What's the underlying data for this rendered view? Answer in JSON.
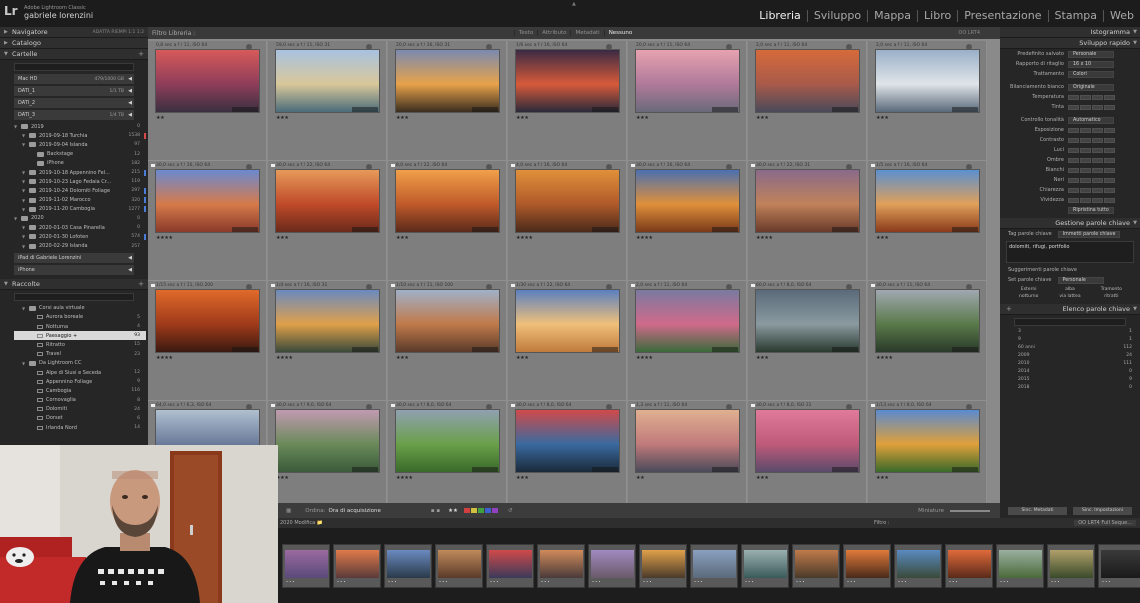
{
  "app": {
    "name": "Adobe Lightroom Classic",
    "user": "gabriele lorenzini"
  },
  "modules": [
    "Libreria",
    "Sviluppo",
    "Mappa",
    "Libro",
    "Presentazione",
    "Stampa",
    "Web"
  ],
  "left_panel": {
    "navigator": {
      "title": "Navigatore",
      "zoom": "ADATTA  RIEMPI  1:1  1:2"
    },
    "catalog": "Catalogo",
    "folders": {
      "title": "Cartelle",
      "volumes": [
        {
          "name": "Mac HD",
          "count": "479/1000 GB"
        },
        {
          "name": "DATI_1",
          "count": "1/1 TB"
        },
        {
          "name": "DATI_2",
          "count": ""
        },
        {
          "name": "DATI_3",
          "count": "1/4 TB"
        }
      ],
      "tree": [
        {
          "indent": 0,
          "label": "2019",
          "count": "0"
        },
        {
          "indent": 1,
          "label": "2019-09-18 Turchia",
          "count": "1538",
          "mark": "#d64a4a"
        },
        {
          "indent": 1,
          "label": "2019-09-04 Islanda",
          "count": "97"
        },
        {
          "indent": 2,
          "label": "Backstage",
          "count": "12"
        },
        {
          "indent": 2,
          "label": "iPhone",
          "count": "182"
        },
        {
          "indent": 1,
          "label": "2019-10-18 Appennino Fel...",
          "count": "215",
          "mark": "#4a7bd6"
        },
        {
          "indent": 1,
          "label": "2019-10-23 Lago Fedaia Cr...",
          "count": "119"
        },
        {
          "indent": 1,
          "label": "2019-10-24 Dolomiti Foliage",
          "count": "297",
          "mark": "#4a7bd6"
        },
        {
          "indent": 1,
          "label": "2019-11-02 Marocco",
          "count": "320",
          "mark": "#4a7bd6"
        },
        {
          "indent": 1,
          "label": "2019-11-20 Cambogia",
          "count": "1277",
          "mark": "#4a7bd6"
        },
        {
          "indent": 0,
          "label": "2020",
          "count": "0"
        },
        {
          "indent": 1,
          "label": "2020-01-03 Casa Pinarella",
          "count": "0"
        },
        {
          "indent": 1,
          "label": "2020-01-30 Lofoten",
          "count": "574",
          "mark": "#4a7bd6"
        },
        {
          "indent": 1,
          "label": "2020-02-29 Islanda",
          "count": "257"
        }
      ],
      "devices": [
        {
          "name": "iPad di Gabriele Lorenzini"
        },
        {
          "name": "iPhone"
        }
      ]
    },
    "collections": {
      "title": "Raccolte",
      "tree": [
        {
          "indent": 1,
          "label": "Corsi aula virtuale",
          "count": ""
        },
        {
          "indent": 2,
          "label": "Aurora boreale",
          "count": "5"
        },
        {
          "indent": 2,
          "label": "Notturna",
          "count": "4"
        },
        {
          "indent": 2,
          "label": "Paesaggio +",
          "count": "93",
          "selected": true
        },
        {
          "indent": 2,
          "label": "Ritratto",
          "count": "15"
        },
        {
          "indent": 2,
          "label": "Travel",
          "count": "23"
        },
        {
          "indent": 1,
          "label": "Da Lightroom CC",
          "count": ""
        },
        {
          "indent": 2,
          "label": "Alpe di Siusi e Seceda",
          "count": "12"
        },
        {
          "indent": 2,
          "label": "Appennino Foliage",
          "count": "9"
        },
        {
          "indent": 2,
          "label": "Cambogia",
          "count": "116"
        },
        {
          "indent": 2,
          "label": "Cornovaglia",
          "count": "8"
        },
        {
          "indent": 2,
          "label": "Dolomiti",
          "count": "24"
        },
        {
          "indent": 2,
          "label": "Dorset",
          "count": "6"
        },
        {
          "indent": 2,
          "label": "Irlanda Nord",
          "count": "14"
        }
      ]
    }
  },
  "grid": {
    "filter_title": "Filtro Libreria :",
    "filter_tabs": [
      "Testo",
      "Attributo",
      "Metadati",
      "Nessuno"
    ],
    "filter_preset": "OO LRT4",
    "cells": [
      {
        "meta": "0,8 sec a f / 11, ISO 64",
        "stars": "★★",
        "grad": [
          "#d65a5a",
          "#8f3d5a",
          "#3a3040"
        ]
      },
      {
        "meta": "59,0 sec a f / 11, ISO 31",
        "stars": "★★★",
        "grad": [
          "#a8c2e0",
          "#d9c79a",
          "#4a6c7a"
        ]
      },
      {
        "meta": "20,0 sec a f / 16, ISO 31",
        "stars": "★★★",
        "grad": [
          "#7a8ab0",
          "#e8a24a",
          "#3a2e20"
        ]
      },
      {
        "meta": "1/6 sec a f / 16, ISO 64",
        "stars": "★★★",
        "grad": [
          "#3a2a44",
          "#d75a3a",
          "#2a2a3a"
        ]
      },
      {
        "meta": "20,0 sec a f / 11, ISO 64",
        "stars": "★★★",
        "grad": [
          "#e6a2b0",
          "#b07a9a",
          "#6a6a7a"
        ]
      },
      {
        "meta": "2,0 sec a f / 11, ISO 64",
        "stars": "★★★",
        "grad": [
          "#d66a3a",
          "#a85a4a",
          "#4a4a5a"
        ]
      },
      {
        "meta": "2,0 sec a f / 11, ISO 64",
        "stars": "★★★",
        "grad": [
          "#9ab0c8",
          "#e0e4e8",
          "#5a6a7a"
        ]
      },
      {
        "meta": "30,0 sec a f / 16, ISO 64",
        "stars": "★★★★",
        "grad": [
          "#6a8ad0",
          "#d67a4a",
          "#8a3a2a"
        ]
      },
      {
        "meta": "30,0 sec a f / 22, ISO 64",
        "stars": "★★★",
        "grad": [
          "#e69a5a",
          "#c04a2a",
          "#6a2a1a"
        ]
      },
      {
        "meta": "8,0 sec a f / 22, ISO 64",
        "stars": "★★★",
        "grad": [
          "#f0a04a",
          "#c05a2a",
          "#5a2a1a"
        ]
      },
      {
        "meta": "4,0 sec a f / 16, ISO 64",
        "stars": "★★★★",
        "grad": [
          "#e0903a",
          "#b05a2a",
          "#4a2a1a"
        ]
      },
      {
        "meta": "30,0 sec a f / 16, ISO 64",
        "stars": "★★★★",
        "grad": [
          "#4a70b0",
          "#e0903a",
          "#7a3a1a"
        ]
      },
      {
        "meta": "30,0 sec a f / 22, ISO 31",
        "stars": "★★★★",
        "grad": [
          "#8a6a8a",
          "#c0825a",
          "#6a3a2a"
        ]
      },
      {
        "meta": "1/5 sec a f / 16, ISO 64",
        "stars": "★★★",
        "grad": [
          "#5a90d0",
          "#e0a05a",
          "#8a3a1a"
        ]
      },
      {
        "meta": "1/15 sec a f / 11, ISO 200",
        "stars": "★★★★",
        "grad": [
          "#e06a2a",
          "#a03a1a",
          "#3a1a10"
        ]
      },
      {
        "meta": "1/4 sec a f / 16, ISO 31",
        "stars": "★★★★",
        "grad": [
          "#6a8ac0",
          "#e0a04a",
          "#3a4a3a"
        ]
      },
      {
        "meta": "1/10 sec a f / 11, ISO 100",
        "stars": "★★★",
        "grad": [
          "#a0b0c8",
          "#c07a4a",
          "#5a3a2a"
        ]
      },
      {
        "meta": "1/30 sec a f / 22, ISO 64",
        "stars": "★★★",
        "grad": [
          "#5a80c0",
          "#f0c07a",
          "#c07a3a"
        ]
      },
      {
        "meta": "2,0 sec a f / 11, ISO 64",
        "stars": "★★★★",
        "grad": [
          "#7a7aa0",
          "#d06a8a",
          "#3a6a3a"
        ]
      },
      {
        "meta": "60,0 sec a f / 8,0, ISO 64",
        "stars": "★★★",
        "grad": [
          "#5a6a7a",
          "#8a9aa0",
          "#2a3a30"
        ]
      },
      {
        "meta": "30,0 sec a f / 11, ISO 64",
        "stars": "★★★★",
        "grad": [
          "#a0a8b0",
          "#5a7a4a",
          "#2a3a2a"
        ]
      },
      {
        "meta": "64,0 sec a f / 6,3, ISO 64",
        "stars": "",
        "grad": [
          "#b0c0d0",
          "#6a7a9a",
          "#4a5a6a"
        ]
      },
      {
        "meta": "30,0 sec a f / 9,0, ISO 64",
        "stars": "★★★",
        "grad": [
          "#c09ab0",
          "#6a8a5a",
          "#3a5a3a"
        ]
      },
      {
        "meta": "30,0 sec a f / 8,0, ISO 64",
        "stars": "★★★★",
        "grad": [
          "#90a0b0",
          "#6aa04a",
          "#3a6a2a"
        ]
      },
      {
        "meta": "30,0 sec a f / 8,0, ISO 64",
        "stars": "★★★",
        "grad": [
          "#d04a4a",
          "#3a6aa0",
          "#1a2a3a"
        ]
      },
      {
        "meta": "1,3 sec a f / 11, ISO 64",
        "stars": "★★",
        "grad": [
          "#e0b090",
          "#c07a7a",
          "#4a4a5a"
        ]
      },
      {
        "meta": "30,0 sec a f / 8,0, ISO 31",
        "stars": "★★★",
        "grad": [
          "#e07a9a",
          "#c05a7a",
          "#5a4a6a"
        ]
      },
      {
        "meta": "1/13 sec a f / 8,0, ISO 64",
        "stars": "★★★",
        "grad": [
          "#5a8ad0",
          "#e0a03a",
          "#3a6a2a"
        ]
      }
    ],
    "toolbar": {
      "sort_label": "Ordina:",
      "sort_value": "Ora di acquisizione",
      "stars": "★★",
      "thumb_label": "Miniature"
    }
  },
  "right_panel": {
    "histogram": "Istogramma",
    "quick_develop": {
      "title": "Sviluppo rapido",
      "preset_label": "Predefinito salvato",
      "preset_value": "Personale",
      "crop_label": "Rapporto di ritaglio",
      "crop_value": "16 x 10",
      "treatment_label": "Trattamento",
      "treatment_value": "Colori",
      "wb_label": "Bilanciamento bianco",
      "wb_value": "Originale",
      "wb_rows": [
        "Temperatura",
        "Tinta"
      ],
      "tone_label": "Controllo tonalità",
      "tone_auto": "Automatico",
      "tone_rows": [
        "Esposizione",
        "Contrasto",
        "Luci",
        "Ombre",
        "Bianchi",
        "Neri",
        "Chiarezza",
        "Vividezza"
      ],
      "reset": "Ripristina tutto"
    },
    "keywording": {
      "title": "Gestione parole chiave",
      "tag_label": "Tag parole chiave",
      "tag_value": "Immetti parole chiave",
      "keywords": "dolomiti, rifugi, portfolio",
      "suggest": "Suggerimenti parole chiave",
      "set_label": "Set parole chiave",
      "set_value": "Personale",
      "set_items": [
        "Esterni",
        "alba",
        "Tramonto",
        "notturno",
        "via lattea",
        "ritratti"
      ]
    },
    "keyword_list": {
      "title": "Elenco parole chiave",
      "items": [
        {
          "label": "3",
          "count": "1"
        },
        {
          "label": "9",
          "count": "1"
        },
        {
          "label": "60 anni",
          "count": "112"
        },
        {
          "label": "2009",
          "count": "24"
        },
        {
          "label": "2010",
          "count": "111"
        },
        {
          "label": "2014",
          "count": "0"
        },
        {
          "label": "2015",
          "count": "9"
        },
        {
          "label": "2018",
          "count": "0"
        }
      ]
    },
    "sync_metadata": "Sinc. Metadati",
    "sync_settings": "Sinc. Impostazioni"
  },
  "filmstrip": {
    "source": "2020 Modifica 📁",
    "filter_label": "Filtro :",
    "preset": "OO LRT4 Full Seque...",
    "frames": [
      [
        "#9a6aa0",
        "#5a4a7a"
      ],
      [
        "#e07a4a",
        "#5a3a3a"
      ],
      [
        "#6a8ac0",
        "#2a3a4a"
      ],
      [
        "#c08a5a",
        "#5a3a2a"
      ],
      [
        "#d04a4a",
        "#3a3a5a"
      ],
      [
        "#d08a5a",
        "#4a3a3a"
      ],
      [
        "#a08ac0",
        "#6a5a6a"
      ],
      [
        "#e0a04a",
        "#4a3a2a"
      ],
      [
        "#8aa0c0",
        "#5a6a7a"
      ],
      [
        "#9ab0b0",
        "#3a5a5a"
      ],
      [
        "#c07a4a",
        "#4a3a2a"
      ],
      [
        "#e07a3a",
        "#4a2a1a"
      ],
      [
        "#5a8ac0",
        "#3a4a3a"
      ],
      [
        "#e06a3a",
        "#5a2a1a"
      ],
      [
        "#9ab0a0",
        "#4a6a3a"
      ],
      [
        "#b0a06a",
        "#3a4a2a"
      ],
      [
        "#3a3a3a",
        "#1a1a1a"
      ],
      [
        "#c0c0c0",
        "#5a5a5a"
      ],
      [
        "#e08a5a",
        "#4a2a2a"
      ],
      [
        "#8a9ab0",
        "#4a4a5a"
      ]
    ]
  },
  "colors": {
    "accent": "#d9d9d9",
    "panel": "#262626",
    "grid_bg": "#8a8a8a"
  }
}
